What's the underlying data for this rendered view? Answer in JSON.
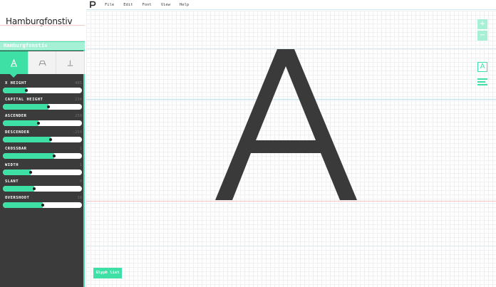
{
  "app": {
    "font_preview_text": "Hamburgfonstiv",
    "font_name": "Hamburgfonstiv"
  },
  "menu": [
    "File",
    "Edit",
    "Font",
    "View",
    "Help"
  ],
  "tabs": [
    {
      "name": "tab-glyph-params",
      "icon": "letter-a-icon",
      "active": true
    },
    {
      "name": "tab-font-params",
      "icon": "letter-ab-icon",
      "active": false
    },
    {
      "name": "tab-serif-params",
      "icon": "serif-icon",
      "active": false
    }
  ],
  "parameters": [
    {
      "label": "X HEIGHT",
      "value": "485",
      "level": 0.3
    },
    {
      "label": "CAPITAL HEIGHT",
      "value": "234",
      "level": 0.58
    },
    {
      "label": "ASCENDER",
      "value": "250",
      "level": 0.45
    },
    {
      "label": "DESCENDER",
      "value": "-250",
      "level": 0.6
    },
    {
      "label": "CROSSBAR",
      "value": "1",
      "level": 0.65
    },
    {
      "label": "WIDTH",
      "value": "1",
      "level": 0.35
    },
    {
      "label": "SLANT",
      "value": "0",
      "level": 0.4
    },
    {
      "label": "OVERSHOOT",
      "value": "10",
      "level": 0.5
    }
  ],
  "canvas": {
    "glyph_char": "A",
    "zoom_in": "+",
    "zoom_out": "−",
    "mode_label": "A"
  },
  "footer": {
    "glyph_list_label": "Glyph list"
  },
  "colors": {
    "accent": "#3fe0a6",
    "accent_light": "#a6f0d6",
    "sidebar_bg": "#3b3b3b",
    "glyph": "#3a3a3a"
  }
}
